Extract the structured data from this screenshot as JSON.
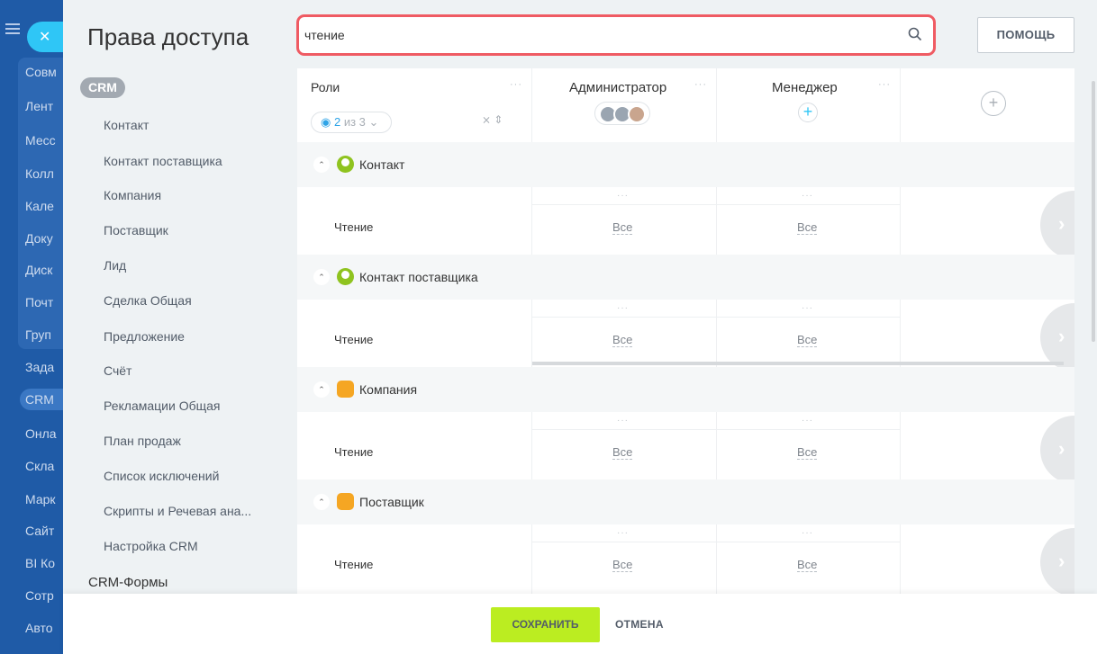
{
  "portal_sidebar": {
    "items": [
      "Совм",
      "Лент",
      "Месс",
      "Колл",
      "Кале",
      "Доку",
      "Диск",
      "Почт",
      "Груп",
      "Зада",
      "CRM",
      "Онла",
      "Скла",
      "Марк",
      "Сайт",
      "BI Ко",
      "Сотр",
      "Авто"
    ],
    "active_index": 10
  },
  "header": {
    "title": "Права доступа",
    "search_value": "чтение",
    "help_label": "ПОМОЩЬ"
  },
  "left_menu": {
    "section": "CRM",
    "items": [
      "Контакт",
      "Контакт поставщика",
      "Компания",
      "Поставщик",
      "Лид",
      "Сделка Общая",
      "Предложение",
      "Счёт",
      "Рекламации Общая",
      "План продаж",
      "Список исключений",
      "Скрипты и Речевая ана...",
      "Настройка CRM"
    ],
    "bottom_item": "CRM-Формы"
  },
  "table": {
    "roles_label": "Роли",
    "role_filter": {
      "count": "2",
      "of_total": "из 3"
    },
    "columns": [
      "Администратор",
      "Менеджер"
    ],
    "add_icon": "+",
    "sections": [
      {
        "title": "Контакт",
        "icon": "person-icon",
        "row_label": "Чтение",
        "values": [
          "Все",
          "Все"
        ]
      },
      {
        "title": "Контакт поставщика",
        "icon": "person-icon",
        "row_label": "Чтение",
        "values": [
          "Все",
          "Все"
        ]
      },
      {
        "title": "Компания",
        "icon": "building-icon",
        "row_label": "Чтение",
        "values": [
          "Все",
          "Все"
        ]
      },
      {
        "title": "Поставщик",
        "icon": "building-icon",
        "row_label": "Чтение",
        "values": [
          "Все",
          "Все"
        ]
      }
    ]
  },
  "footer": {
    "save_label": "СОХРАНИТЬ",
    "cancel_label": "ОТМЕНА"
  },
  "colors": {
    "accent_blue": "#2fc6f6",
    "search_border": "#ef5b63",
    "save_green": "#bbed21",
    "contact_icon": "#8fc31f",
    "company_icon": "#f5a623"
  }
}
